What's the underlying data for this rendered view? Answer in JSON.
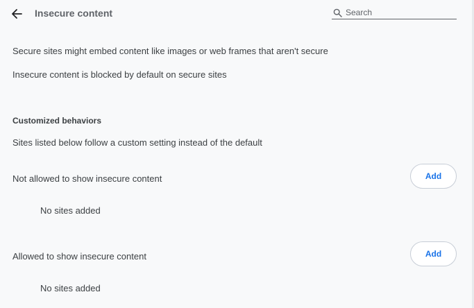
{
  "header": {
    "back_icon": "arrow-back-icon",
    "title": "Insecure content",
    "search": {
      "icon": "search-icon",
      "placeholder": "Search",
      "value": ""
    }
  },
  "description": {
    "line1": "Secure sites might embed content like images or web frames that aren't secure",
    "line2": "Insecure content is blocked by default on secure sites"
  },
  "customized": {
    "title": "Customized behaviors",
    "subtitle": "Sites listed below follow a custom setting instead of the default"
  },
  "lists": [
    {
      "label": "Not allowed to show insecure content",
      "add_label": "Add",
      "empty_text": "No sites added"
    },
    {
      "label": "Allowed to show insecure content",
      "add_label": "Add",
      "empty_text": "No sites added"
    }
  ],
  "colors": {
    "accent": "#1a73e8",
    "background": "#f8f9fa",
    "text": "#3c4043"
  }
}
